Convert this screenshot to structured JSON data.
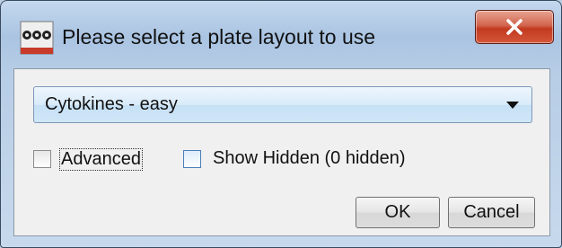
{
  "window": {
    "title": "Please select a plate layout to use",
    "icon": "plate-app-icon",
    "close_icon": "close-icon"
  },
  "combo": {
    "selected": "Cytokines - easy",
    "arrow_icon": "chevron-down-icon"
  },
  "options": {
    "advanced_label": "Advanced",
    "advanced_checked": false,
    "show_hidden_label": "Show Hidden (0 hidden)",
    "show_hidden_checked": false
  },
  "buttons": {
    "ok": "OK",
    "cancel": "Cancel"
  },
  "colors": {
    "close_button": "#c94a33",
    "combo_fill": "#d9ebf9",
    "window_frame": "#aac4e2"
  }
}
